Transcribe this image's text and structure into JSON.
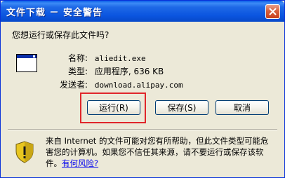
{
  "window": {
    "title": "文件下载 － 安全警告"
  },
  "prompt": {
    "question": "您想运行或保存此文件吗?"
  },
  "file": {
    "name_label": "名称:",
    "name_value": "aliedit.exe",
    "type_label": "类型:",
    "type_value": "应用程序, 636 KB",
    "sender_label": "发送者:",
    "sender_value": "download.alipay.com"
  },
  "buttons": {
    "run": "运行(R)",
    "save": "保存(S)",
    "cancel": "取消"
  },
  "warning": {
    "text": "来自 Internet 的文件可能对您有所帮助，但此文件类型可能危害您的计算机。如果您不信任其来源，请不要运行或保存该软件。",
    "link": "有何风险?"
  },
  "colors": {
    "titlebar": "#0b55e0",
    "dialog_bg": "#ece9d8",
    "highlight": "#e0262a",
    "link": "#0000ee"
  },
  "icons": {
    "close": "close-icon",
    "app": "application-window-icon",
    "shield": "security-shield-icon"
  }
}
